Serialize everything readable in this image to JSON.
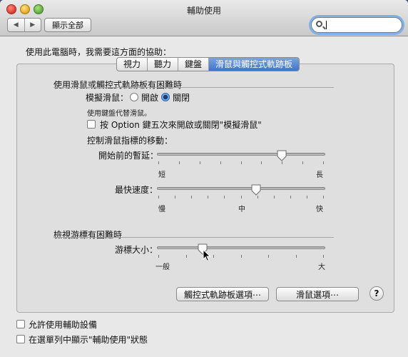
{
  "window": {
    "title": "輔助使用"
  },
  "toolbar": {
    "back": "◀",
    "forward": "▶",
    "show_all": "顯示全部",
    "search_value": ""
  },
  "intro": "使用此電腦時，我需要這方面的協助：",
  "tabs": [
    {
      "label": "視力",
      "active": false
    },
    {
      "label": "聽力",
      "active": false
    },
    {
      "label": "鍵盤",
      "active": false
    },
    {
      "label": "滑鼠與觸控式軌跡板",
      "active": true
    }
  ],
  "mouse_section": {
    "title": "使用滑鼠或觸控式軌跡板有困難時",
    "mouse_keys_label": "模擬滑鼠：",
    "on_label": "開啟",
    "off_label": "關閉",
    "selected": "off",
    "hint": "使用鍵盤代替滑鼠。",
    "option_checkbox_label": "按 Option 鍵五次來開啟或關閉\"模擬滑鼠\"",
    "option_checked": false,
    "pointer_movement": "控制滑鼠指標的移動：",
    "initial_delay": {
      "label": "開始前的暫延：",
      "min": "短",
      "max": "長",
      "value": 0.74
    },
    "max_speed": {
      "label": "最快速度：",
      "min": "慢",
      "mid": "中",
      "max": "快",
      "value": 0.59
    }
  },
  "cursor_section": {
    "title": "檢視游標有困難時",
    "cursor_size": {
      "label": "游標大小：",
      "min": "一般",
      "max": "大",
      "value": 0.27
    }
  },
  "buttons": {
    "trackpad_options": "觸控式軌跡板選項⋯",
    "mouse_options": "滑鼠選項⋯",
    "help": "?"
  },
  "footer": {
    "allow_assistive": "允許使用輔助設備",
    "show_in_menu": "在選單列中顯示\"輔助使用\"狀態"
  }
}
